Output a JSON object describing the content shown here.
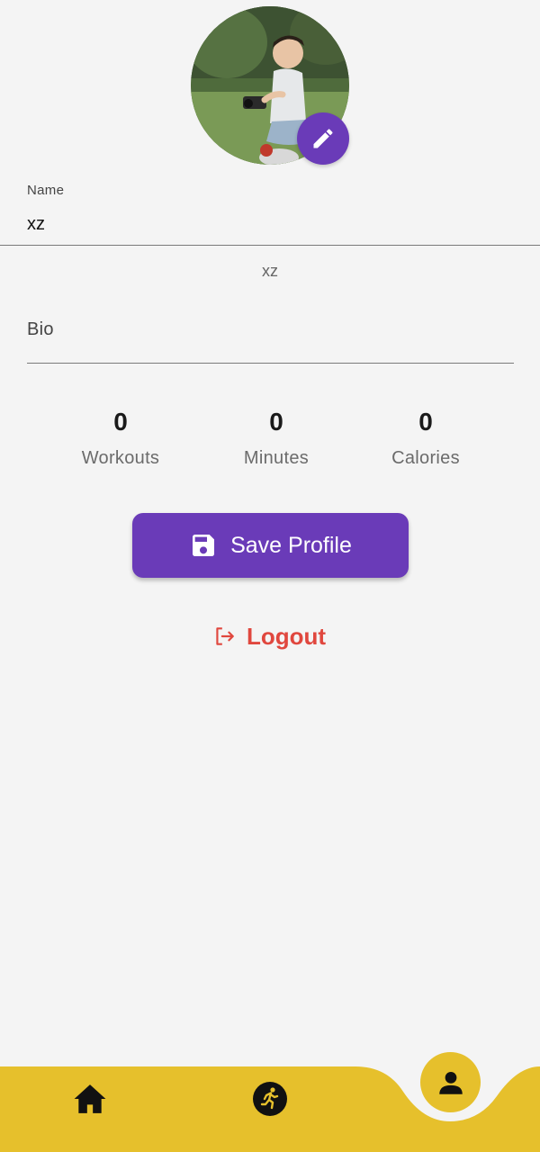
{
  "profile": {
    "avatar_alt": "Profile photo",
    "edit_icon": "pencil-icon"
  },
  "name_field": {
    "label": "Name",
    "value": "xz",
    "display_name": "xz"
  },
  "bio_field": {
    "label": "Bio",
    "value": ""
  },
  "stats": [
    {
      "value": "0",
      "label": "Workouts"
    },
    {
      "value": "0",
      "label": "Minutes"
    },
    {
      "value": "0",
      "label": "Calories"
    }
  ],
  "actions": {
    "save_label": "Save Profile",
    "save_icon": "floppy-disk-icon",
    "logout_label": "Logout",
    "logout_icon": "logout-icon"
  },
  "bottom_nav": {
    "items": [
      {
        "icon": "home-icon",
        "active": false
      },
      {
        "icon": "running-icon",
        "active": false
      },
      {
        "icon": "person-icon",
        "active": true
      }
    ]
  },
  "colors": {
    "primary": "#6a3bb8",
    "accent_yellow": "#e6c02c",
    "danger": "#e0473e",
    "background": "#f4f4f4"
  }
}
